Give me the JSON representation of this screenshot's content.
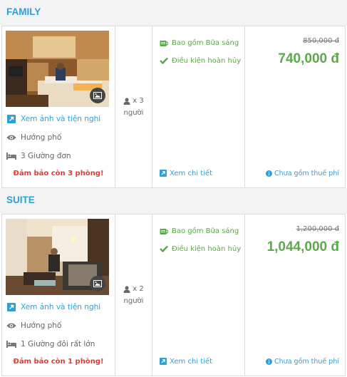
{
  "rooms": [
    {
      "title": "FAMILY",
      "photo_alt": "Family room with beds",
      "view_link": "Xem ảnh và tiện nghi",
      "view_type": "Hướng phố",
      "beds": "3 Giường đơn",
      "guarantee": "Đảm bảo còn 3 phòng!",
      "guests": "x 3",
      "guests_unit": "người",
      "breakfast": "Bao gồm Bữa sáng",
      "cancel": "Điều kiện hoàn hủy",
      "detail": "Xem chi tiết",
      "old_price": "850,000 đ",
      "price": "740,000 đ",
      "tax": "Chưa gồm thuế phí"
    },
    {
      "title": "SUITE",
      "photo_alt": "Suite room with sofa and bed",
      "view_link": "Xem ảnh và tiện nghi",
      "view_type": "Hướng phố",
      "beds": "1 Giường đôi rất lớn",
      "guarantee": "Đảm bảo còn 1 phòng!",
      "guests": "x 2",
      "guests_unit": "người",
      "breakfast": "Bao gồm Bữa sáng",
      "cancel": "Điều kiện hoàn hủy",
      "detail": "Xem chi tiết",
      "old_price": "1,200,000 đ",
      "price": "1,044,000 đ",
      "tax": "Chưa gồm thuế phí"
    }
  ],
  "colors": {
    "accent": "#2f9fd6",
    "price": "#5aaa47",
    "alert": "#e13a34",
    "condition": "#5aa64a"
  },
  "icons": [
    "external-link-icon",
    "eye-icon",
    "bed-icon",
    "user-icon",
    "coffee-cup-icon",
    "check-icon",
    "info-icon",
    "gallery-icon"
  ]
}
